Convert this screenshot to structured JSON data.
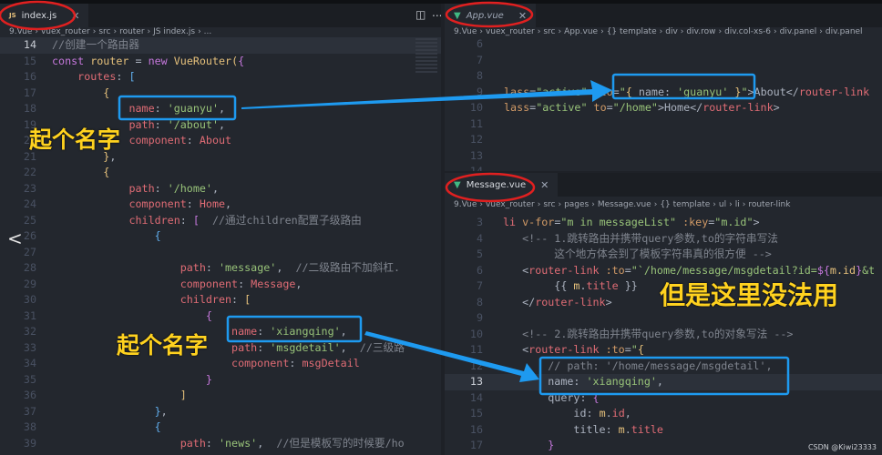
{
  "left": {
    "tab": {
      "icon": "js-file-icon",
      "icon_text": "JS",
      "label": "index.js"
    },
    "breadcrumb": [
      "9.Vue",
      "vuex_router",
      "src",
      "router",
      "JS index.js",
      "..."
    ],
    "lines": [
      {
        "n": "14",
        "t": [
          [
            "c",
            "//创建一个路由器"
          ]
        ]
      },
      {
        "n": "15",
        "t": [
          [
            "k",
            "const "
          ],
          [
            "y",
            "router"
          ],
          [
            "t",
            " = "
          ],
          [
            "k",
            "new "
          ],
          [
            "y",
            "VueRouter"
          ],
          [
            "b3",
            "("
          ],
          [
            "b1",
            "{"
          ]
        ]
      },
      {
        "n": "16",
        "t": [
          [
            "t",
            "    "
          ],
          [
            "p",
            "routes"
          ],
          [
            "t",
            ": "
          ],
          [
            "b2",
            "["
          ]
        ]
      },
      {
        "n": "17",
        "t": [
          [
            "t",
            "        "
          ],
          [
            "b3",
            "{"
          ]
        ]
      },
      {
        "n": "18",
        "t": [
          [
            "t",
            "            "
          ],
          [
            "p",
            "name"
          ],
          [
            "t",
            ": "
          ],
          [
            "s",
            "'guanyu'"
          ],
          [
            "t",
            ","
          ]
        ]
      },
      {
        "n": "19",
        "t": [
          [
            "t",
            "            "
          ],
          [
            "p",
            "path"
          ],
          [
            "t",
            ": "
          ],
          [
            "s",
            "'/about'"
          ],
          [
            "t",
            ","
          ]
        ]
      },
      {
        "n": "20",
        "t": [
          [
            "t",
            "            "
          ],
          [
            "p",
            "component"
          ],
          [
            "t",
            ": "
          ],
          [
            "p",
            "About"
          ]
        ]
      },
      {
        "n": "21",
        "t": [
          [
            "t",
            "        "
          ],
          [
            "b3",
            "}"
          ],
          [
            "t",
            ","
          ]
        ]
      },
      {
        "n": "22",
        "t": [
          [
            "t",
            "        "
          ],
          [
            "b3",
            "{"
          ]
        ]
      },
      {
        "n": "23",
        "t": [
          [
            "t",
            "            "
          ],
          [
            "p",
            "path"
          ],
          [
            "t",
            ": "
          ],
          [
            "s",
            "'/home'"
          ],
          [
            "t",
            ","
          ]
        ]
      },
      {
        "n": "24",
        "t": [
          [
            "t",
            "            "
          ],
          [
            "p",
            "component"
          ],
          [
            "t",
            ": "
          ],
          [
            "p",
            "Home"
          ],
          [
            "t",
            ","
          ]
        ]
      },
      {
        "n": "25",
        "t": [
          [
            "t",
            "            "
          ],
          [
            "p",
            "children"
          ],
          [
            "t",
            ": "
          ],
          [
            "b1",
            "["
          ],
          [
            "t",
            "  "
          ],
          [
            "c",
            "//通过children配置子级路由"
          ]
        ]
      },
      {
        "n": "26",
        "t": [
          [
            "t",
            "                "
          ],
          [
            "b2",
            "{"
          ]
        ]
      },
      {
        "n": "27",
        "t": []
      },
      {
        "n": "28",
        "t": [
          [
            "t",
            "                    "
          ],
          [
            "p",
            "path"
          ],
          [
            "t",
            ": "
          ],
          [
            "s",
            "'message'"
          ],
          [
            "t",
            ",  "
          ],
          [
            "c",
            "//二级路由不加斜杠."
          ]
        ]
      },
      {
        "n": "29",
        "t": [
          [
            "t",
            "                    "
          ],
          [
            "p",
            "component"
          ],
          [
            "t",
            ": "
          ],
          [
            "p",
            "Message"
          ],
          [
            "t",
            ","
          ]
        ]
      },
      {
        "n": "30",
        "t": [
          [
            "t",
            "                    "
          ],
          [
            "p",
            "children"
          ],
          [
            "t",
            ": "
          ],
          [
            "b3",
            "["
          ]
        ]
      },
      {
        "n": "31",
        "t": [
          [
            "t",
            "                        "
          ],
          [
            "b1",
            "{"
          ]
        ]
      },
      {
        "n": "32",
        "t": [
          [
            "t",
            "                            "
          ],
          [
            "p",
            "name"
          ],
          [
            "t",
            ": "
          ],
          [
            "s",
            "'xiangqing'"
          ],
          [
            "t",
            ","
          ]
        ]
      },
      {
        "n": "33",
        "t": [
          [
            "t",
            "                            "
          ],
          [
            "p",
            "path"
          ],
          [
            "t",
            ": "
          ],
          [
            "s",
            "'msgdetail'"
          ],
          [
            "t",
            ",  "
          ],
          [
            "c",
            "//三级路"
          ]
        ]
      },
      {
        "n": "34",
        "t": [
          [
            "t",
            "                            "
          ],
          [
            "p",
            "component"
          ],
          [
            "t",
            ": "
          ],
          [
            "p",
            "msgDetail"
          ]
        ]
      },
      {
        "n": "35",
        "t": [
          [
            "t",
            "                        "
          ],
          [
            "b1",
            "}"
          ]
        ]
      },
      {
        "n": "36",
        "t": [
          [
            "t",
            "                    "
          ],
          [
            "b3",
            "]"
          ]
        ]
      },
      {
        "n": "37",
        "t": [
          [
            "t",
            "                "
          ],
          [
            "b2",
            "}"
          ],
          [
            "t",
            ","
          ]
        ]
      },
      {
        "n": "38",
        "t": [
          [
            "t",
            "                "
          ],
          [
            "b2",
            "{"
          ]
        ]
      },
      {
        "n": "39",
        "t": [
          [
            "t",
            "                    "
          ],
          [
            "p",
            "path"
          ],
          [
            "t",
            ": "
          ],
          [
            "s",
            "'news'"
          ],
          [
            "t",
            ",  "
          ],
          [
            "c",
            "//但是模板写的时候要/ho"
          ]
        ]
      }
    ]
  },
  "app": {
    "tab": {
      "icon": "vue-file-icon",
      "label": "App.vue"
    },
    "breadcrumb": [
      "9.Vue",
      "vuex_router",
      "src",
      "App.vue",
      "{} template",
      "div",
      "div.row",
      "div.col-xs-6",
      "div.panel",
      "div.panel"
    ],
    "lines": [
      {
        "n": "6",
        "t": []
      },
      {
        "n": "7",
        "t": []
      },
      {
        "n": "8",
        "t": []
      },
      {
        "n": "9",
        "t": [
          [
            "o",
            "lass"
          ],
          [
            "t",
            "="
          ],
          [
            "s",
            "\"active\""
          ],
          [
            "t",
            " "
          ],
          [
            "o",
            ":to"
          ],
          [
            "t",
            "="
          ],
          [
            "s",
            "\""
          ],
          [
            "b3",
            "{"
          ],
          [
            "t",
            " name: "
          ],
          [
            "s",
            "'guanyu'"
          ],
          [
            "t",
            " "
          ],
          [
            "b3",
            "}"
          ],
          [
            "s",
            "\""
          ],
          [
            "t",
            ">About</"
          ],
          [
            "p",
            "router-link"
          ]
        ]
      },
      {
        "n": "10",
        "t": [
          [
            "o",
            "lass"
          ],
          [
            "t",
            "="
          ],
          [
            "s",
            "\"active\""
          ],
          [
            "t",
            " "
          ],
          [
            "o",
            "to"
          ],
          [
            "t",
            "="
          ],
          [
            "s",
            "\"/home\""
          ],
          [
            "t",
            ">Home</"
          ],
          [
            "p",
            "router-link"
          ],
          [
            "t",
            ">"
          ]
        ]
      },
      {
        "n": "11",
        "t": []
      },
      {
        "n": "12",
        "t": []
      },
      {
        "n": "13",
        "t": []
      },
      {
        "n": "14",
        "t": []
      }
    ]
  },
  "message": {
    "tab": {
      "icon": "vue-file-icon",
      "label": "Message.vue"
    },
    "breadcrumb": [
      "9.Vue",
      "vuex_router",
      "src",
      "pages",
      "Message.vue",
      "{} template",
      "ul",
      "li",
      "router-link"
    ],
    "lines": [
      {
        "n": "3",
        "t": [
          [
            "p",
            "li "
          ],
          [
            "o",
            "v-for"
          ],
          [
            "t",
            "="
          ],
          [
            "s",
            "\"m in messageList\""
          ],
          [
            "t",
            " "
          ],
          [
            "o",
            ":key"
          ],
          [
            "t",
            "="
          ],
          [
            "s",
            "\"m.id\""
          ],
          [
            "t",
            ">"
          ]
        ]
      },
      {
        "n": "4",
        "t": [
          [
            "t",
            "   "
          ],
          [
            "c",
            "<!-- 1.跳转路由并携带query参数,to的字符串写法"
          ]
        ]
      },
      {
        "n": "5",
        "t": [
          [
            "c",
            "        这个地方体会到了模板字符串真的很方便 -->"
          ]
        ]
      },
      {
        "n": "6",
        "t": [
          [
            "t",
            "   <"
          ],
          [
            "p",
            "router-link"
          ],
          [
            "t",
            " "
          ],
          [
            "o",
            ":to"
          ],
          [
            "t",
            "="
          ],
          [
            "s",
            "\"`/home/message/msgdetail?id="
          ],
          [
            "k",
            "${"
          ],
          [
            "y",
            "m.id"
          ],
          [
            "k",
            "}"
          ],
          [
            "s",
            "&t"
          ]
        ]
      },
      {
        "n": "7",
        "t": [
          [
            "t",
            "        {{ "
          ],
          [
            "y",
            "m"
          ],
          [
            "t",
            "."
          ],
          [
            "p",
            "title"
          ],
          [
            "t",
            " }}"
          ]
        ]
      },
      {
        "n": "8",
        "t": [
          [
            "t",
            "   </"
          ],
          [
            "p",
            "router-link"
          ],
          [
            "t",
            ">"
          ]
        ]
      },
      {
        "n": "9",
        "t": []
      },
      {
        "n": "10",
        "t": [
          [
            "t",
            "   "
          ],
          [
            "c",
            "<!-- 2.跳转路由并携带query参数,to的对象写法 -->"
          ]
        ]
      },
      {
        "n": "11",
        "t": [
          [
            "t",
            "   <"
          ],
          [
            "p",
            "router-link"
          ],
          [
            "t",
            " "
          ],
          [
            "o",
            ":to"
          ],
          [
            "t",
            "="
          ],
          [
            "s",
            "\""
          ],
          [
            "b3",
            "{"
          ]
        ]
      },
      {
        "n": "12",
        "t": [
          [
            "t",
            "       "
          ],
          [
            "c",
            "// path: '/home/message/msgdetail',"
          ]
        ]
      },
      {
        "n": "13",
        "t": [
          [
            "t",
            "       name: "
          ],
          [
            "s",
            "'xiangqing'"
          ],
          [
            "t",
            ","
          ]
        ]
      },
      {
        "n": "14",
        "t": [
          [
            "t",
            "       query: "
          ],
          [
            "b1",
            "{"
          ]
        ]
      },
      {
        "n": "15",
        "t": [
          [
            "t",
            "           id: "
          ],
          [
            "y",
            "m"
          ],
          [
            "t",
            "."
          ],
          [
            "p",
            "id"
          ],
          [
            "t",
            ","
          ]
        ]
      },
      {
        "n": "16",
        "t": [
          [
            "t",
            "           title: "
          ],
          [
            "y",
            "m"
          ],
          [
            "t",
            "."
          ],
          [
            "p",
            "title"
          ]
        ]
      },
      {
        "n": "17",
        "t": [
          [
            "t",
            "       "
          ],
          [
            "b1",
            "}"
          ]
        ]
      }
    ]
  },
  "annotations": {
    "name_it_1": "起个名字",
    "name_it_2": "起个名字",
    "cannot_use_here": "但是这里没法用"
  },
  "toolbar": {
    "split_icon": "split-editor-icon",
    "more_icon": "more-icon",
    "more_label": "..."
  },
  "nav": {
    "back_icon": "chevron-left-icon",
    "back_label": "<"
  },
  "watermark": "CSDN @Kiwi23333",
  "colors": {
    "annotation_box": "#1e9af0",
    "annotation_text": "#ffd21f",
    "circle": "#e02020",
    "background": "#23272e"
  }
}
